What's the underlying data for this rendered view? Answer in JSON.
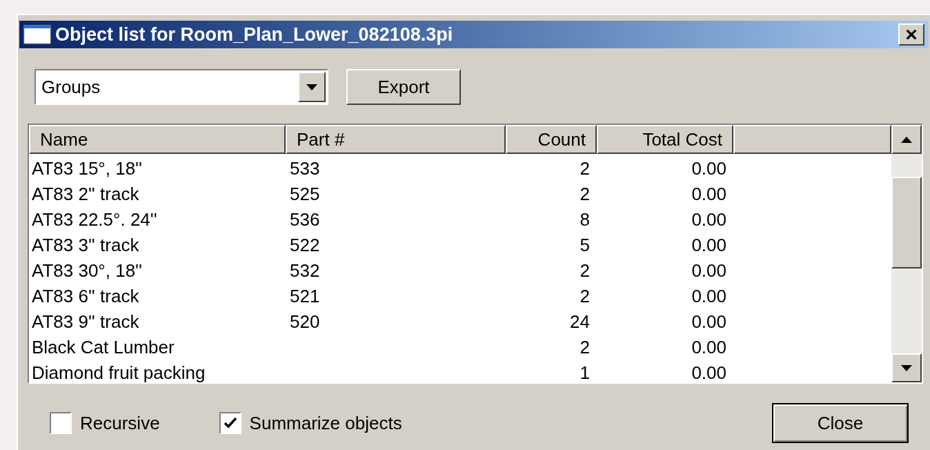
{
  "window": {
    "title": "Object list for Room_Plan_Lower_082108.3pi",
    "close_glyph": "×"
  },
  "view_select": {
    "value": "Groups"
  },
  "export_button": "Export",
  "table": {
    "columns": [
      {
        "label": "Name"
      },
      {
        "label": "Part #"
      },
      {
        "label": "Count"
      },
      {
        "label": "Total Cost"
      }
    ],
    "rows": [
      {
        "cells": [
          "AT83 15°, 18''",
          "533",
          "2",
          "0.00"
        ]
      },
      {
        "cells": [
          "AT83 2'' track",
          "525",
          "2",
          "0.00"
        ]
      },
      {
        "cells": [
          "AT83 22.5°. 24''",
          "536",
          "8",
          "0.00"
        ]
      },
      {
        "cells": [
          "AT83 3'' track",
          "522",
          "5",
          "0.00"
        ]
      },
      {
        "cells": [
          "AT83 30°, 18''",
          "532",
          "2",
          "0.00"
        ]
      },
      {
        "cells": [
          "AT83 6'' track",
          "521",
          "2",
          "0.00"
        ]
      },
      {
        "cells": [
          "AT83 9'' track",
          "520",
          "24",
          "0.00"
        ]
      },
      {
        "cells": [
          "Black Cat Lumber",
          "",
          "2",
          "0.00"
        ]
      },
      {
        "cells": [
          "Diamond fruit packing",
          "",
          "1",
          "0.00"
        ]
      }
    ]
  },
  "options": [
    {
      "label": "Recursive",
      "checked": false
    },
    {
      "label": "Summarize objects",
      "checked": true
    }
  ],
  "close_button": "Close"
}
